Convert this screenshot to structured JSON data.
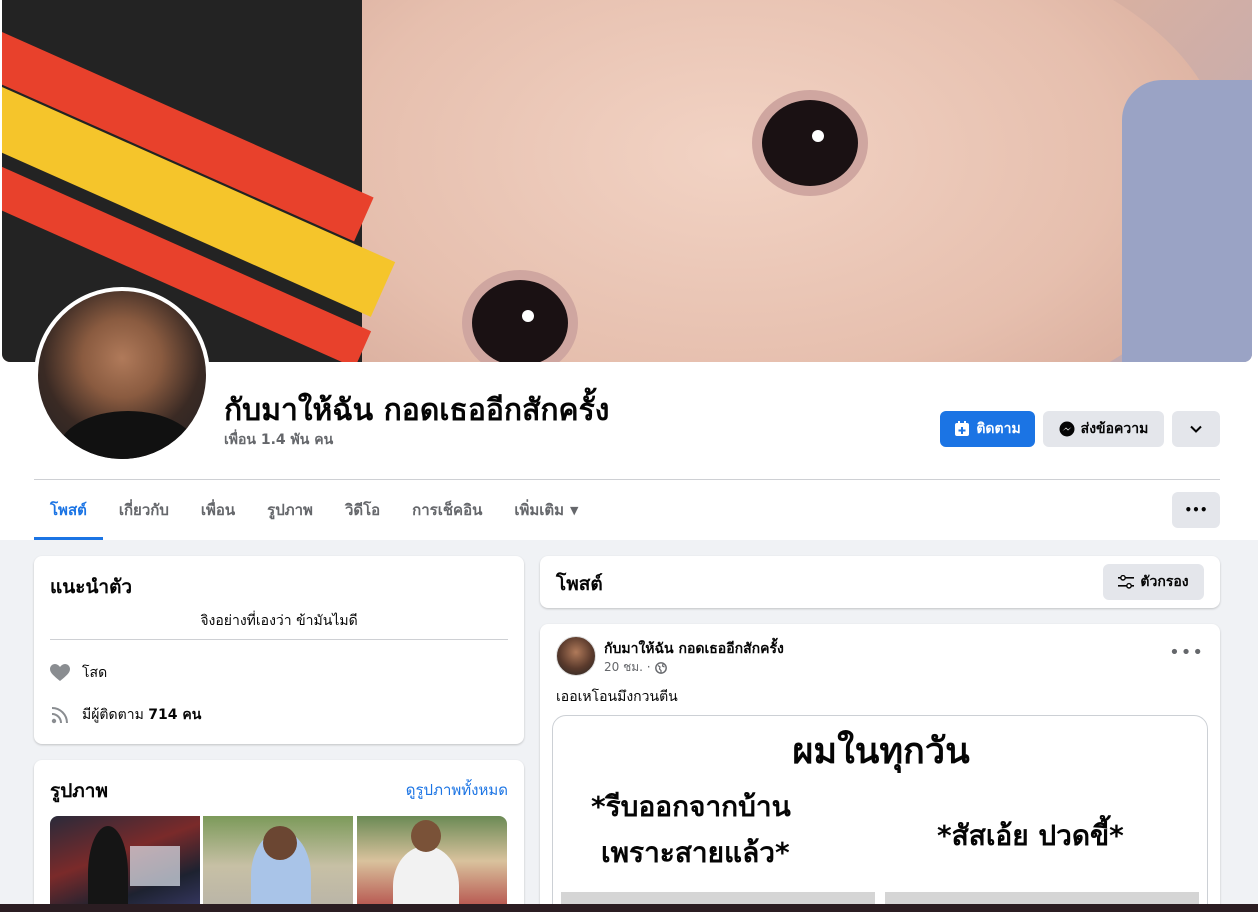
{
  "profile": {
    "name": "กับมาให้ฉัน กอดเธออีกสักครั้ง",
    "friends": "เพื่อน 1.4 พัน คน"
  },
  "actions": {
    "follow_label": "ติดตาม",
    "message_label": "ส่งข้อความ",
    "more_glyph": "⌄",
    "tab_more_glyph": "•••"
  },
  "tabs": [
    {
      "label": "โพสต์",
      "active": true
    },
    {
      "label": "เกี่ยวกับ"
    },
    {
      "label": "เพื่อน"
    },
    {
      "label": "รูปภาพ"
    },
    {
      "label": "วิดีโอ"
    },
    {
      "label": "การเช็คอิน"
    },
    {
      "label": "เพิ่มเติม",
      "caret": "▼"
    }
  ],
  "intro": {
    "title": "แนะนำตัว",
    "bio": "จิงอย่างที่เองว่า ข้ามันไมดี",
    "relationship": "โสด",
    "followers_prefix": "มีผู้ติดตาม ",
    "followers_count": "714 คน"
  },
  "photos": {
    "title": "รูปภาพ",
    "see_all": "ดูรูปภาพทั้งหมด"
  },
  "posts": {
    "title": "โพสต์",
    "filter_label": "ตัวกรอง"
  },
  "post": {
    "author": "กับมาให้ฉัน กอดเธออีกสักครั้ง",
    "time": "20 ชม. ·",
    "menu": "•••",
    "text": "เออเหโอนมึงกวนตีน",
    "image": {
      "title": "ผมในทุกวัน",
      "left_line1": "*รีบออกจากบ้าน",
      "left_line2": "เพราะสายแล้ว*",
      "right_line": "*สัสเอ้ย ปวดขี้*"
    }
  },
  "colors": {
    "accent": "#1b74e4",
    "background": "#f0f2f5",
    "secondary_text": "#65676b"
  }
}
